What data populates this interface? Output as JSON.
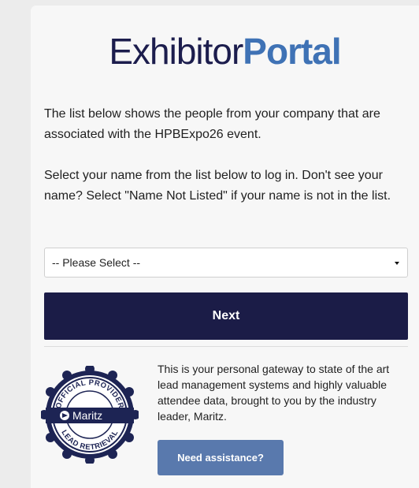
{
  "brand": {
    "part1": "Exhibitor",
    "part2": "Portal"
  },
  "intro": "The list below shows the people from your company that are associated with the HPBExpo26 event.",
  "instructions": "Select your name from the list below to log in. Don't see your name? Select \"Name Not Listed\" if your name is not in the list.",
  "name_select": {
    "selected": "-- Please Select --"
  },
  "next_label": "Next",
  "badge": {
    "top_text": "OFFICIAL PROVIDER",
    "brand": "Maritz",
    "bottom_text": "LEAD RETRIEVAL"
  },
  "info": "This is your personal gateway to state of the art lead management systems and highly valuable attendee data, brought to you by the industry leader, Maritz.",
  "assist_label": "Need assistance?",
  "colors": {
    "navy": "#1b1c47",
    "brand_blue": "#3f72b5",
    "assist": "#5979ad"
  }
}
